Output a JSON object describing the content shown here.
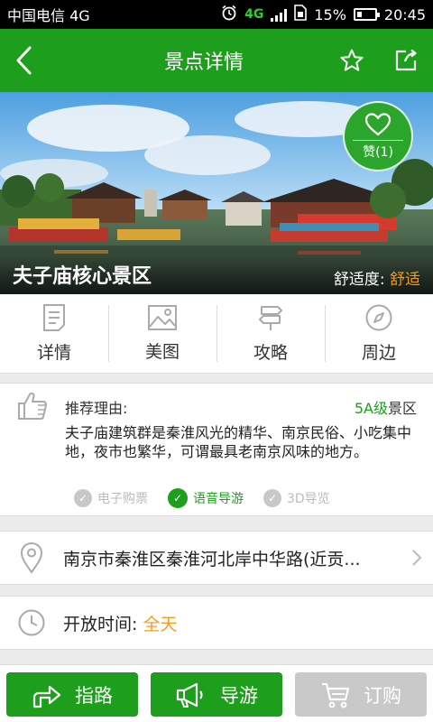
{
  "status": {
    "carrier": "中国电信 4G",
    "net": "4G",
    "battery": "15%",
    "time": "20:45"
  },
  "header": {
    "title": "景点详情"
  },
  "hero": {
    "name": "夫子庙核心景区",
    "comfort_label": "舒适度:",
    "comfort_value": "舒适",
    "like_label": "赞(1)"
  },
  "tabs": [
    {
      "label": "详情",
      "icon": "document-icon"
    },
    {
      "label": "美图",
      "icon": "image-icon"
    },
    {
      "label": "攻略",
      "icon": "signpost-icon"
    },
    {
      "label": "周边",
      "icon": "compass-icon"
    }
  ],
  "recommend": {
    "title": "推荐理由:",
    "level": "5A级",
    "level_suffix": "景区",
    "description": "夫子庙建筑群是秦淮风光的精华、南京民俗、小吃集中地，夜市也繁华，可谓最具老南京风味的地方。",
    "features": [
      {
        "label": "电子购票",
        "active": false
      },
      {
        "label": "语音导游",
        "active": true
      },
      {
        "label": "3D导览",
        "active": false
      }
    ]
  },
  "address": {
    "text": "南京市秦淮区秦淮河北岸中华路(近贡..."
  },
  "hours": {
    "label": "开放时间:",
    "value": "全天"
  },
  "actions": {
    "route": "指路",
    "guide": "导游",
    "order": "订购"
  },
  "colors": {
    "primary": "#1d9f1d",
    "accent": "#f39c1f",
    "disabled": "#c9c9c9"
  }
}
